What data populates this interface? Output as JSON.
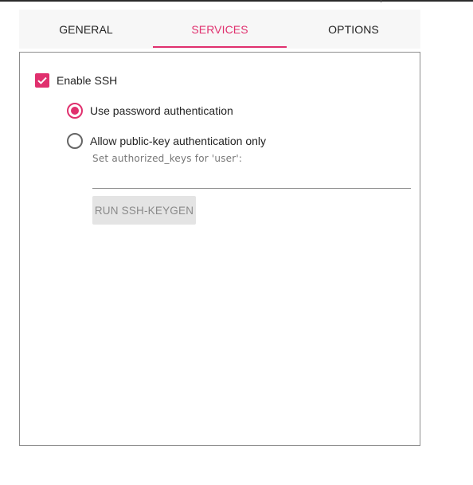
{
  "tabs": [
    {
      "label": "GENERAL",
      "active": false
    },
    {
      "label": "SERVICES",
      "active": true
    },
    {
      "label": "OPTIONS",
      "active": false
    }
  ],
  "services": {
    "enable_ssh": {
      "label": "Enable SSH",
      "checked": true
    },
    "auth_options": [
      {
        "label": "Use password authentication",
        "selected": true
      },
      {
        "label": "Allow public-key authentication only",
        "selected": false
      }
    ],
    "authorized_keys": {
      "label": "Set authorized_keys for 'user':",
      "value": "",
      "placeholder": ""
    },
    "keygen_button": {
      "label": "RUN SSH-KEYGEN",
      "enabled": false
    }
  },
  "colors": {
    "accent": "#e0306e",
    "tab_bar_bg": "#f7f7f7",
    "disabled_button_bg": "#e4e4e4"
  },
  "icons": {
    "checkbox": "check-icon",
    "radio_selected": "radio-selected-icon",
    "radio_unselected": "radio-unselected-icon"
  }
}
